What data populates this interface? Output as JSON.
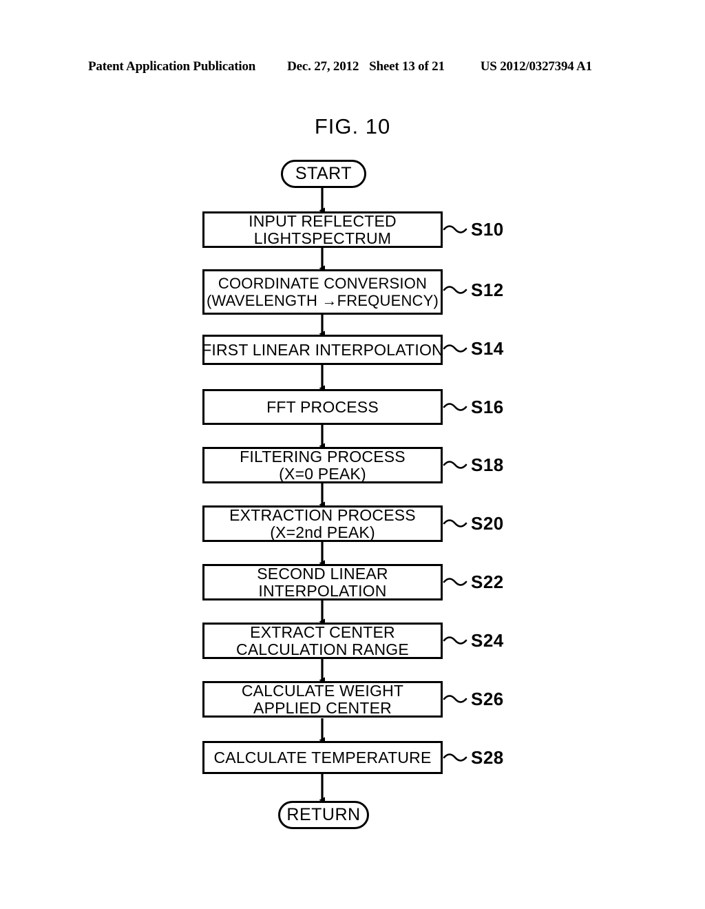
{
  "header": {
    "publication": "Patent Application Publication",
    "date": "Dec. 27, 2012",
    "sheet": "Sheet 13 of 21",
    "number": "US 2012/0327394 A1"
  },
  "figure": {
    "title": "FIG. 10"
  },
  "flowchart": {
    "start": {
      "label": "START"
    },
    "end": {
      "label": "RETURN"
    },
    "steps": [
      {
        "id": "S10",
        "lines": [
          "INPUT REFLECTED",
          "LIGHTSPECTRUM"
        ]
      },
      {
        "id": "S12",
        "lines": [
          "COORDINATE CONVERSION",
          "(WAVELENGTH →FREQUENCY)"
        ]
      },
      {
        "id": "S14",
        "lines": [
          "FIRST LINEAR INTERPOLATION"
        ]
      },
      {
        "id": "S16",
        "lines": [
          "FFT PROCESS"
        ]
      },
      {
        "id": "S18",
        "lines": [
          "FILTERING PROCESS",
          "(X=0 PEAK)"
        ]
      },
      {
        "id": "S20",
        "lines": [
          "EXTRACTION PROCESS",
          "(X=2nd PEAK)"
        ]
      },
      {
        "id": "S22",
        "lines": [
          "SECOND LINEAR",
          "INTERPOLATION"
        ]
      },
      {
        "id": "S24",
        "lines": [
          "EXTRACT CENTER",
          "CALCULATION RANGE"
        ]
      },
      {
        "id": "S26",
        "lines": [
          "CALCULATE WEIGHT",
          "APPLIED CENTER"
        ]
      },
      {
        "id": "S28",
        "lines": [
          "CALCULATE TEMPERATURE"
        ]
      }
    ]
  },
  "colors": {
    "ink": "#000000",
    "paper": "#ffffff"
  }
}
